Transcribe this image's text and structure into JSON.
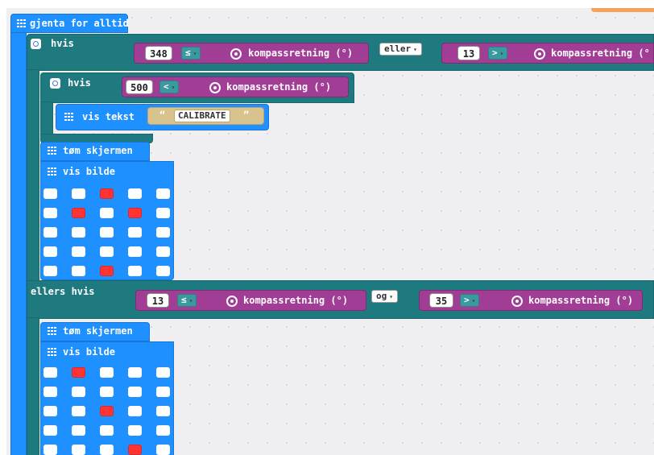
{
  "colors": {
    "basic_blue": "#1E90FF",
    "logic_teal": "#1F7A80",
    "input_purple": "#A23D95",
    "text_tan": "#D8C38F",
    "led_on": "#FF3333",
    "led_off": "#FFFFFF"
  },
  "blocks": {
    "forever_label": "gjenta for alltid",
    "if_label": "hvis",
    "inner_if_label": "hvis",
    "show_text_label": "vis tekst",
    "clear_screen_label": "tøm skjermen",
    "show_image_label": "vis bilde",
    "else_if_label": "ellers hvis",
    "clear_screen_2_label": "tøm skjermen",
    "show_image_2_label": "vis bilde"
  },
  "conditions": {
    "c1": {
      "value": "348",
      "operator": "≤",
      "sensor": "kompassretning (°)"
    },
    "or_operator": "eller",
    "c2": {
      "value": "13",
      "operator": ">",
      "sensor": "kompassretning (°"
    },
    "inner": {
      "value": "500",
      "operator": "<",
      "sensor": "kompassretning (°)"
    },
    "c3": {
      "value": "13",
      "operator": "≤",
      "sensor": "kompassretning (°)"
    },
    "and_operator": "og",
    "c4": {
      "value": "35",
      "operator": ">",
      "sensor": "kompassretning (°)"
    }
  },
  "text_value": "CALIBRATE",
  "quote_open": "“",
  "quote_close": "”",
  "dropdown_arrow": "▾",
  "image1": [
    [
      0,
      0,
      1,
      0,
      0
    ],
    [
      0,
      1,
      0,
      1,
      0
    ],
    [
      0,
      0,
      0,
      0,
      0
    ],
    [
      0,
      0,
      0,
      0,
      0
    ],
    [
      0,
      0,
      1,
      0,
      0
    ]
  ],
  "image2": [
    [
      0,
      1,
      0,
      0,
      0
    ],
    [
      0,
      0,
      0,
      0,
      0
    ],
    [
      0,
      0,
      1,
      0,
      0
    ],
    [
      0,
      0,
      0,
      0,
      0
    ],
    [
      0,
      0,
      0,
      1,
      0
    ]
  ]
}
